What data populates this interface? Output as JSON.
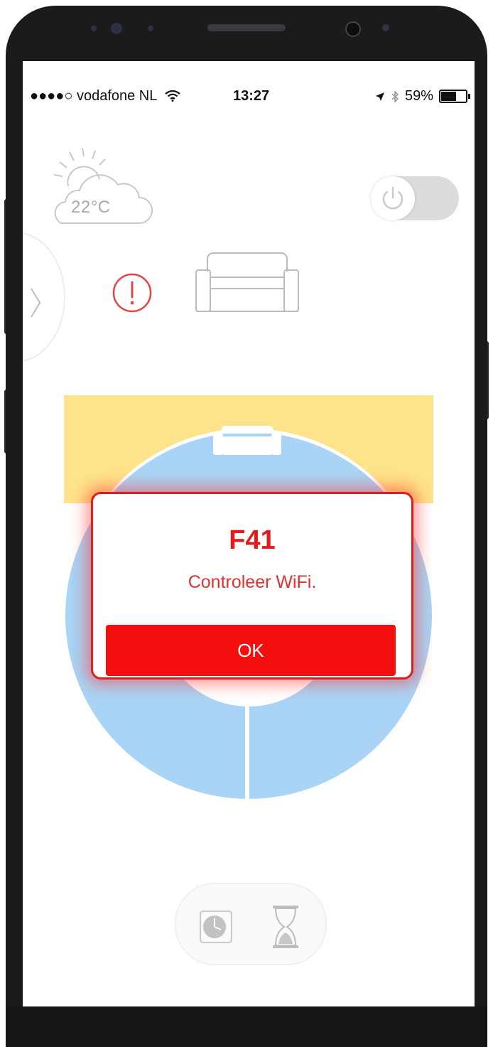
{
  "status_bar": {
    "carrier": "●●●●○ vodafone NL",
    "time": "13:27",
    "battery": "59%",
    "battery_level": 0.59
  },
  "weather": {
    "temperature": "22°C",
    "icon": "partly-cloudy-icon"
  },
  "power_toggle": {
    "icon": "power-icon",
    "state": "off"
  },
  "alert": {
    "icon": "alert-icon",
    "color": "#e64545"
  },
  "mode": {
    "icon": "sofa-icon"
  },
  "dial": {
    "colors": {
      "comfort": "#fde38a",
      "eco": "#a9d4f5"
    }
  },
  "popup": {
    "code": "F41",
    "message": "Controleer  WiFi.",
    "ok_label": "OK",
    "accent": "#f40f0f"
  },
  "bottom": {
    "icons": [
      "clock-icon",
      "hourglass-icon"
    ]
  }
}
